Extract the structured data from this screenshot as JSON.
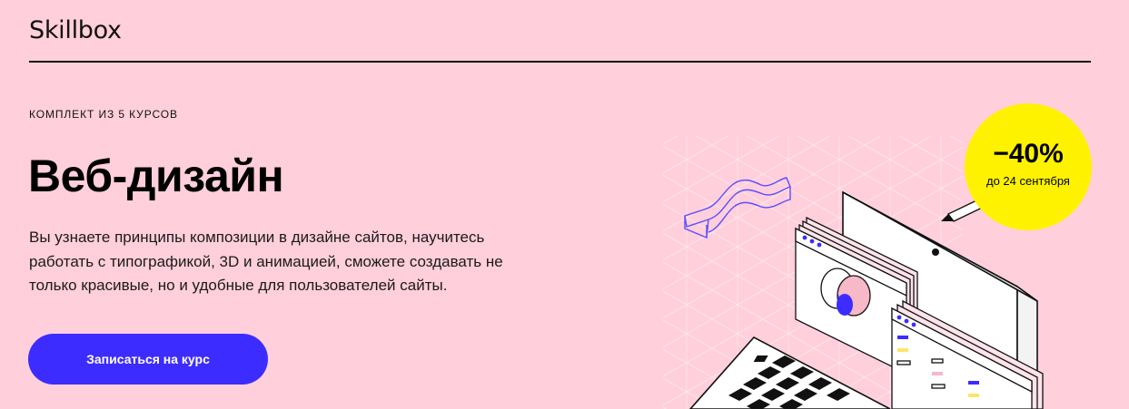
{
  "header": {
    "logo": "Skillbox"
  },
  "hero": {
    "eyebrow": "КОМПЛЕКТ ИЗ 5 КУРСОВ",
    "title": "Веб-дизайн",
    "description": "Вы узнаете принципы композиции в дизайне сайтов, научитесь работать с типографикой, 3D и анимацией, сможете создавать не только красивые, но и удобные для пользователей сайты.",
    "cta_label": "Записаться на курс"
  },
  "badge": {
    "discount": "−40%",
    "until": "до 24 сентября"
  },
  "colors": {
    "background": "#ffcfdb",
    "accent": "#3d2cff",
    "badge": "#fff200",
    "text": "#000000"
  },
  "illustration": {
    "icons": [
      "laptop-icon",
      "wave-3d-icon",
      "pencil-icon",
      "browser-window-icon",
      "venn-circles-icon"
    ]
  }
}
